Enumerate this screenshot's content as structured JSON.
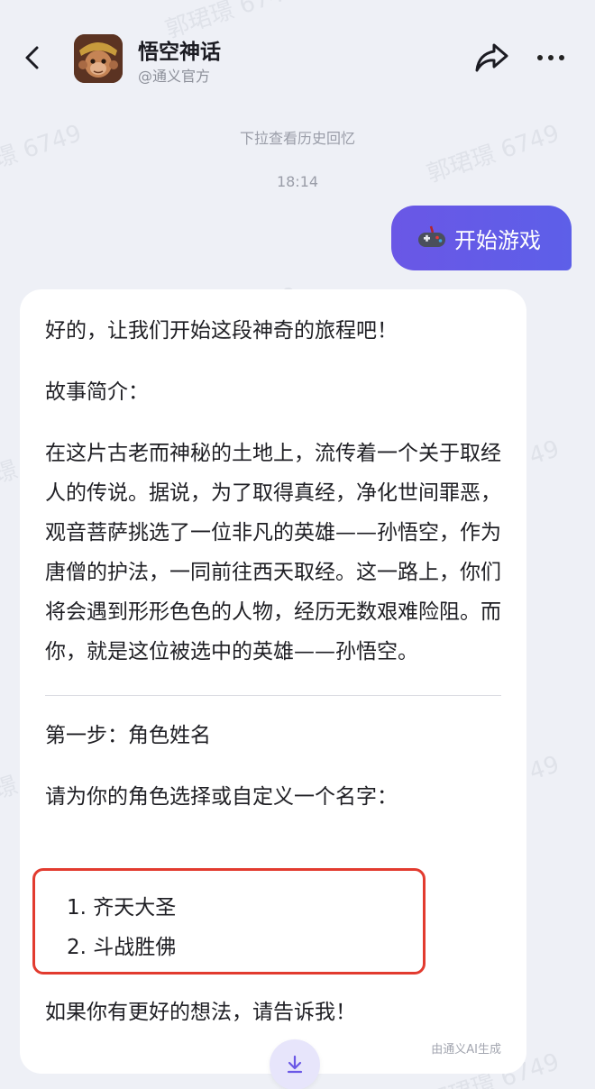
{
  "header": {
    "title": "悟空神话",
    "subtitle": "@通义官方"
  },
  "chat": {
    "history_hint": "下拉查看历史回忆",
    "timestamp": "18:14",
    "user_message": {
      "emoji": "🎮",
      "text": "开始游戏"
    },
    "bot_message": {
      "intro": "好的，让我们开始这段神奇的旅程吧！",
      "story_heading": "故事简介：",
      "story_text": "在这片古老而神秘的土地上，流传着一个关于取经人的传说。据说，为了取得真经，净化世间罪恶，观音菩萨挑选了一位非凡的英雄——孙悟空，作为唐僧的护法，一同前往西天取经。这一路上，你们将会遇到形形色色的人物，经历无数艰难险阻。而你，就是这位被选中的英雄——孙悟空。",
      "step_heading": "第一步：角色姓名",
      "step_prompt": "请为你的角色选择或自定义一个名字：",
      "options": [
        "1. 齐天大圣",
        "2. 斗战胜佛"
      ],
      "closing": "如果你有更好的想法，请告诉我！",
      "ai_note": "由通义AI生成"
    }
  },
  "watermark": {
    "text": "郭珺璟 6749"
  },
  "colors": {
    "background": "#eef0f6",
    "user_bubble": "#6a57e6",
    "highlight_border": "#e23b2f"
  }
}
